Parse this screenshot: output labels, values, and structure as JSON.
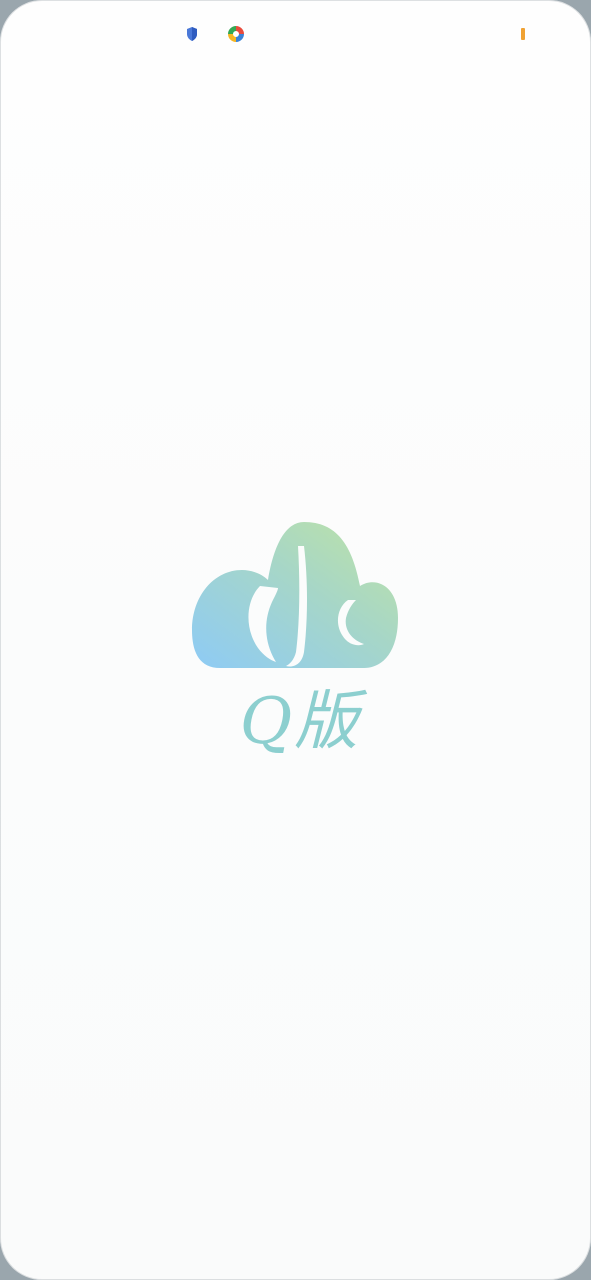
{
  "status_bar": {
    "icons": [
      "shield-icon",
      "color-wheel-icon",
      "battery-icon"
    ]
  },
  "splash": {
    "logo_text": "Q版"
  },
  "colors": {
    "logo_green": "#b8e1a6",
    "logo_blue": "#8ecbf5",
    "logo_text": "#8ccfcf",
    "battery_orange": "#f0a233"
  }
}
